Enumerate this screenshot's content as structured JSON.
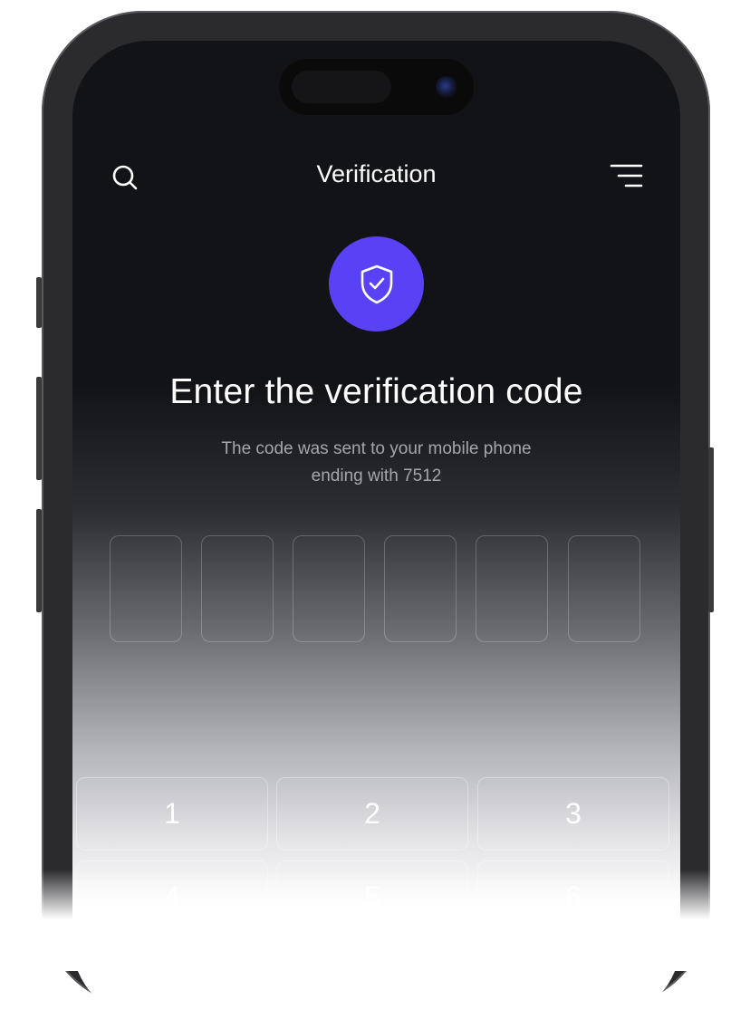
{
  "header": {
    "title": "Verification",
    "left_icon": "search-icon",
    "right_icon": "menu-icon"
  },
  "badge": {
    "icon": "shield-check-icon",
    "color": "#5941f6"
  },
  "content": {
    "headline": "Enter the verification code",
    "subtitle_line1": "The code was sent to your mobile phone",
    "subtitle_line2": "ending with 7512"
  },
  "code_inputs": [
    "",
    "",
    "",
    "",
    "",
    ""
  ],
  "keypad": {
    "keys": [
      "1",
      "2",
      "3",
      "4",
      "5",
      "6"
    ]
  }
}
